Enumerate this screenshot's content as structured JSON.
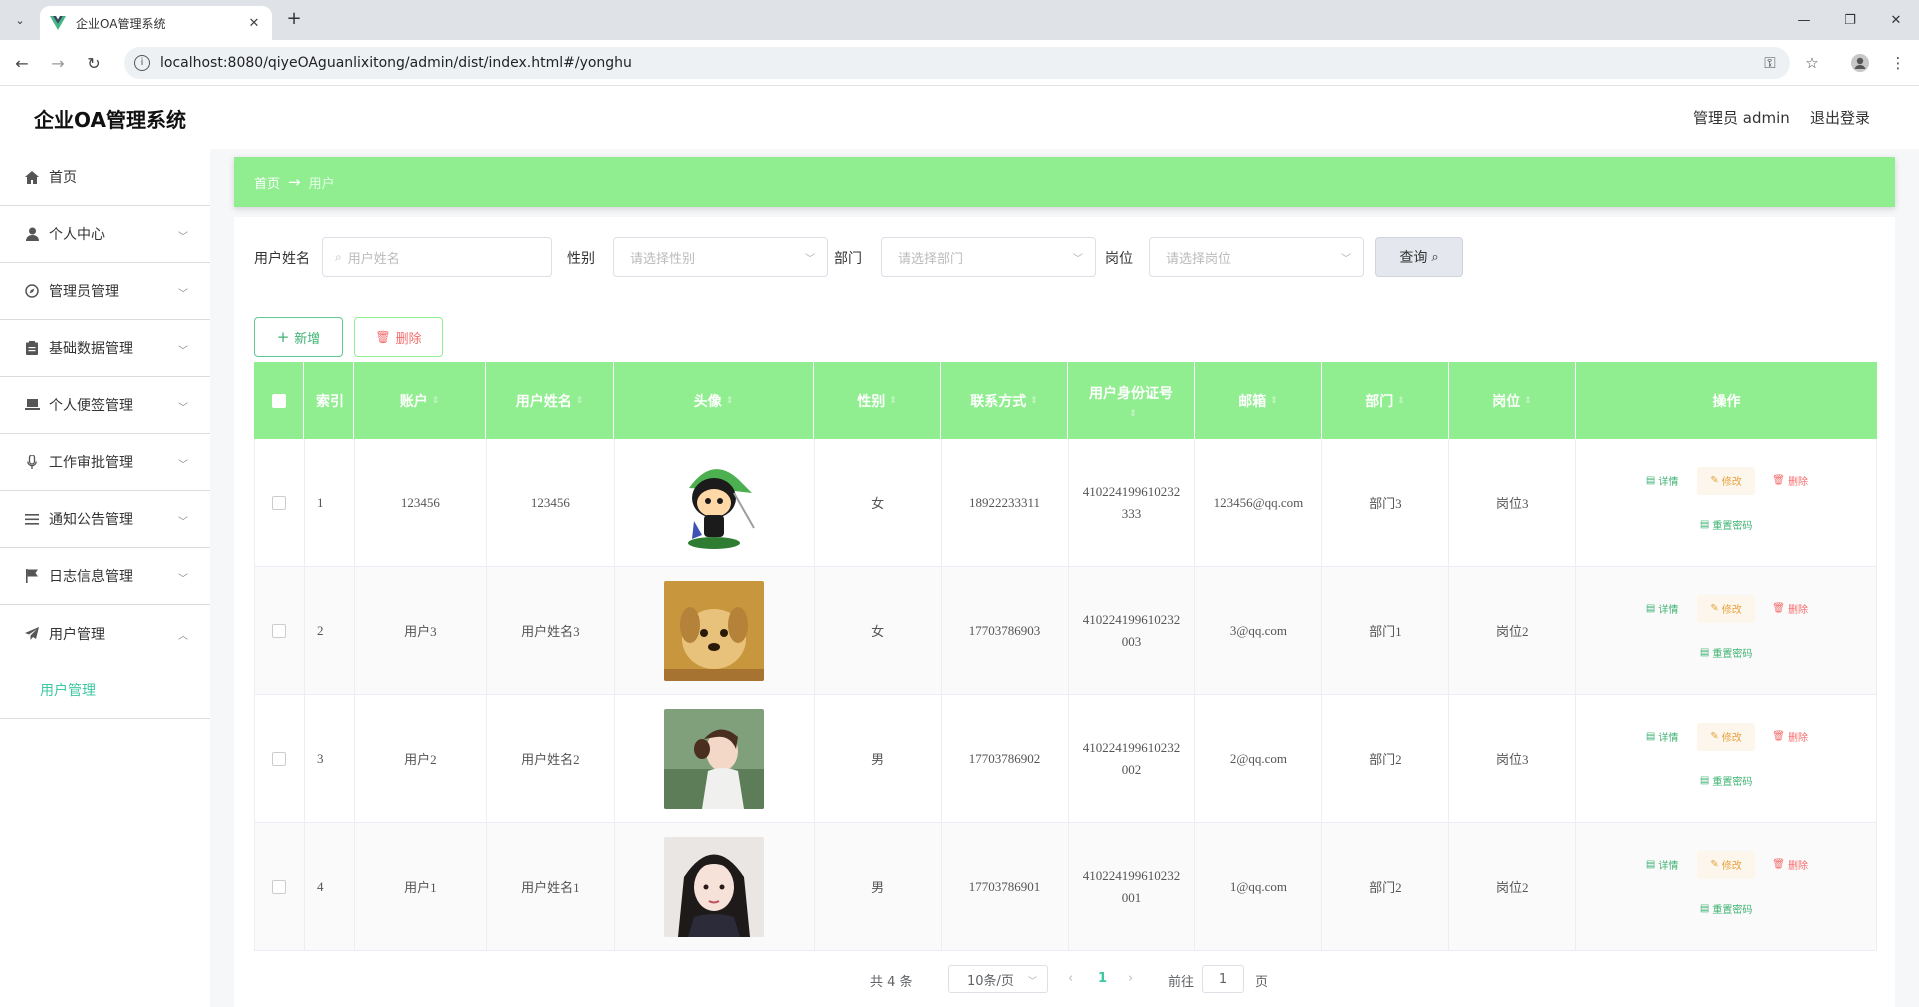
{
  "browser": {
    "tab_title": "企业OA管理系统",
    "url": "localhost:8080/qiyeOAguanlixitong/admin/dist/index.html#/yonghu"
  },
  "header": {
    "app_title": "企业OA管理系统",
    "user": "管理员 admin",
    "logout": "退出登录"
  },
  "sidebar": {
    "items": [
      {
        "label": "首页",
        "icon": "home-icon"
      },
      {
        "label": "个人中心",
        "icon": "user-icon"
      },
      {
        "label": "管理员管理",
        "icon": "compass-icon"
      },
      {
        "label": "基础数据管理",
        "icon": "clipboard-icon"
      },
      {
        "label": "个人便签管理",
        "icon": "laptop-icon"
      },
      {
        "label": "工作审批管理",
        "icon": "microphone-icon"
      },
      {
        "label": "通知公告管理",
        "icon": "list-icon"
      },
      {
        "label": "日志信息管理",
        "icon": "flag-icon"
      },
      {
        "label": "用户管理",
        "icon": "send-icon"
      }
    ],
    "subitem": "用户管理"
  },
  "breadcrumb": {
    "home": "首页",
    "arrow": "→",
    "current": "用户"
  },
  "search": {
    "name_label": "用户姓名",
    "name_placeholder": "用户姓名",
    "gender_label": "性别",
    "gender_placeholder": "请选择性别",
    "dept_label": "部门",
    "dept_placeholder": "请选择部门",
    "post_label": "岗位",
    "post_placeholder": "请选择岗位",
    "query": "查询"
  },
  "actions": {
    "add": "新增",
    "delete": "删除"
  },
  "table": {
    "headers": [
      "索引",
      "账户",
      "用户姓名",
      "头像",
      "性别",
      "联系方式",
      "用户身份证号",
      "邮箱",
      "部门",
      "岗位",
      "操作"
    ],
    "ops": {
      "detail": "详情",
      "edit": "修改",
      "delete": "删除",
      "reset": "重置密码"
    },
    "rows": [
      {
        "index": "1",
        "account": "123456",
        "name": "123456",
        "gender": "女",
        "phone": "18922233311",
        "id_line1": "410224199610232",
        "id_line2": "333",
        "email": "123456@qq.com",
        "dept": "部门3",
        "post": "岗位3"
      },
      {
        "index": "2",
        "account": "用户3",
        "name": "用户姓名3",
        "gender": "女",
        "phone": "17703786903",
        "id_line1": "410224199610232",
        "id_line2": "003",
        "email": "3@qq.com",
        "dept": "部门1",
        "post": "岗位2"
      },
      {
        "index": "3",
        "account": "用户2",
        "name": "用户姓名2",
        "gender": "男",
        "phone": "17703786902",
        "id_line1": "410224199610232",
        "id_line2": "002",
        "email": "2@qq.com",
        "dept": "部门2",
        "post": "岗位3"
      },
      {
        "index": "4",
        "account": "用户1",
        "name": "用户姓名1",
        "gender": "男",
        "phone": "17703786901",
        "id_line1": "410224199610232",
        "id_line2": "001",
        "email": "1@qq.com",
        "dept": "部门2",
        "post": "岗位2"
      }
    ]
  },
  "pager": {
    "total": "共 4 条",
    "size": "10条/页",
    "page": "1",
    "goto_label": "前往",
    "goto_value": "1",
    "page_suffix": "页"
  },
  "colors": {
    "accent": "#90ee90",
    "active_menu": "#3cc8a0"
  }
}
